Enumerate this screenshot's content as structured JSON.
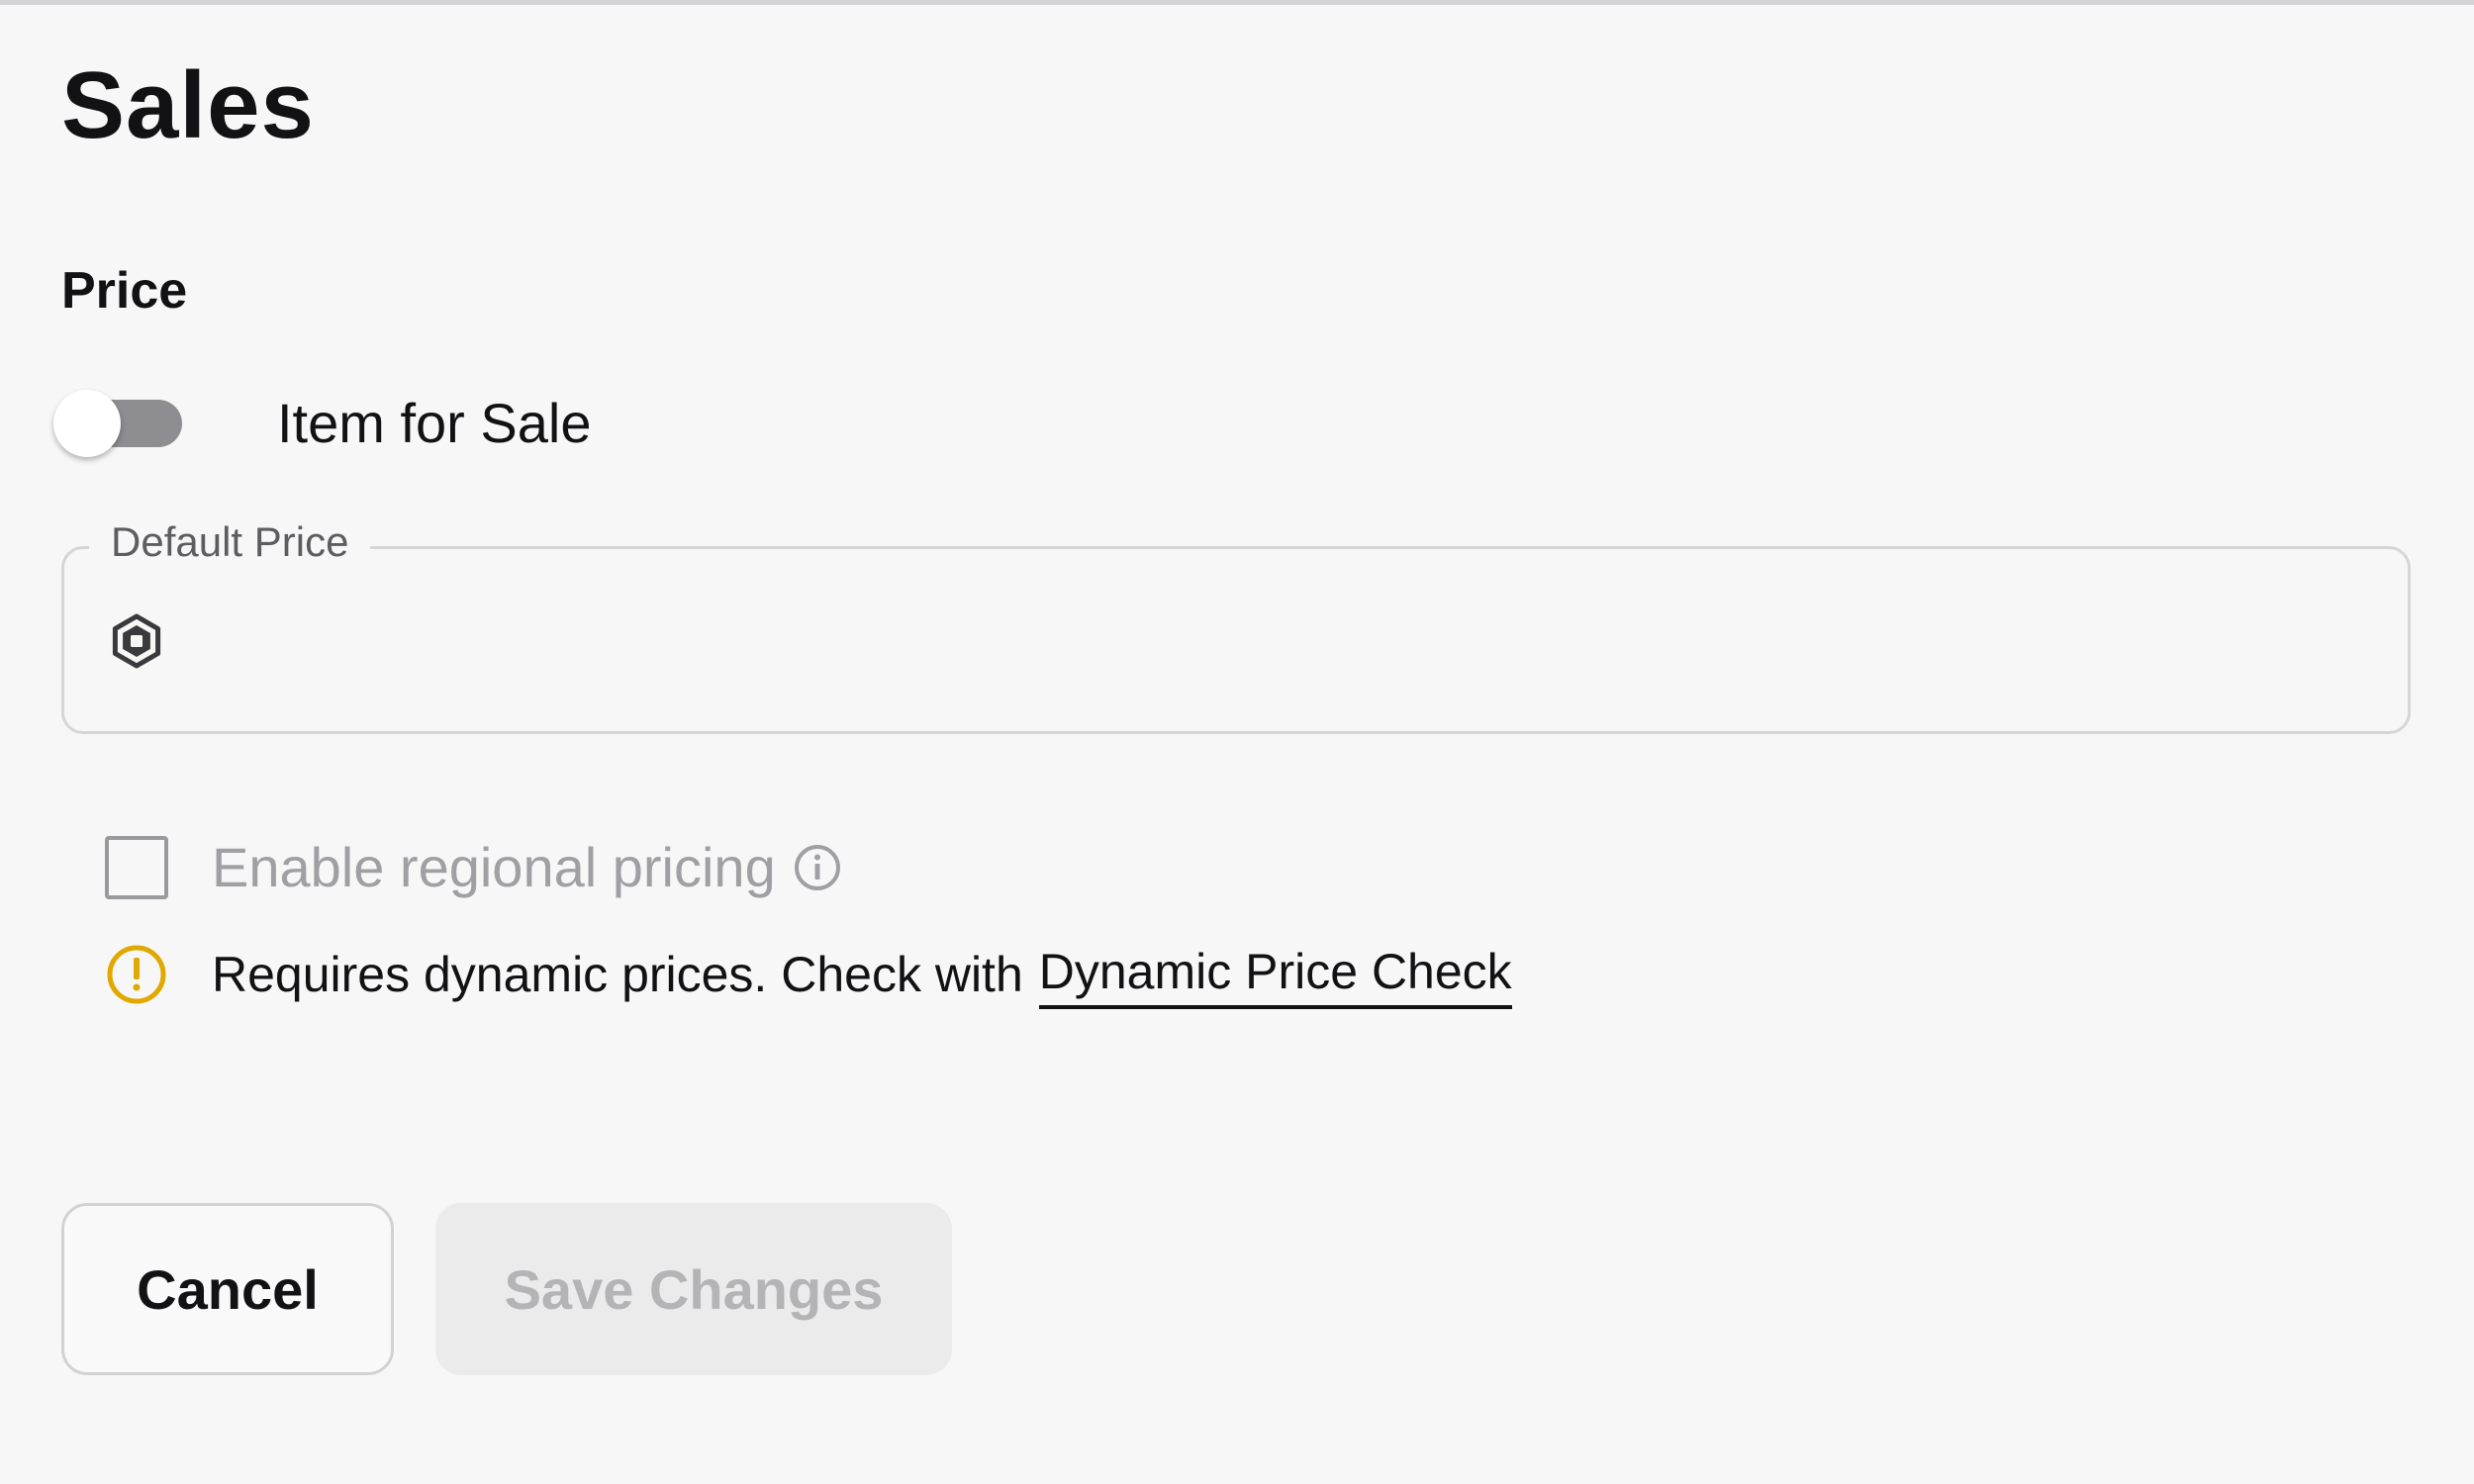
{
  "page": {
    "title": "Sales"
  },
  "price_section": {
    "title": "Price",
    "item_for_sale": {
      "label": "Item for Sale",
      "enabled": false
    },
    "default_price": {
      "legend": "Default Price",
      "value": "",
      "currency_icon": "robux-icon"
    }
  },
  "regional_pricing": {
    "label": "Enable regional pricing",
    "checked": false,
    "info_icon": "info-icon"
  },
  "warning": {
    "icon": "warning-icon",
    "text": "Requires dynamic prices. Check with",
    "link_text": "Dynamic Price Check",
    "color": "#e0a800"
  },
  "actions": {
    "cancel_label": "Cancel",
    "save_label": "Save Changes",
    "save_enabled": false
  },
  "colors": {
    "background": "#f7f7f7",
    "toggle_track_off": "#8e8e92",
    "disabled_text": "#a0a0a4",
    "field_border": "#d6d6d9"
  }
}
